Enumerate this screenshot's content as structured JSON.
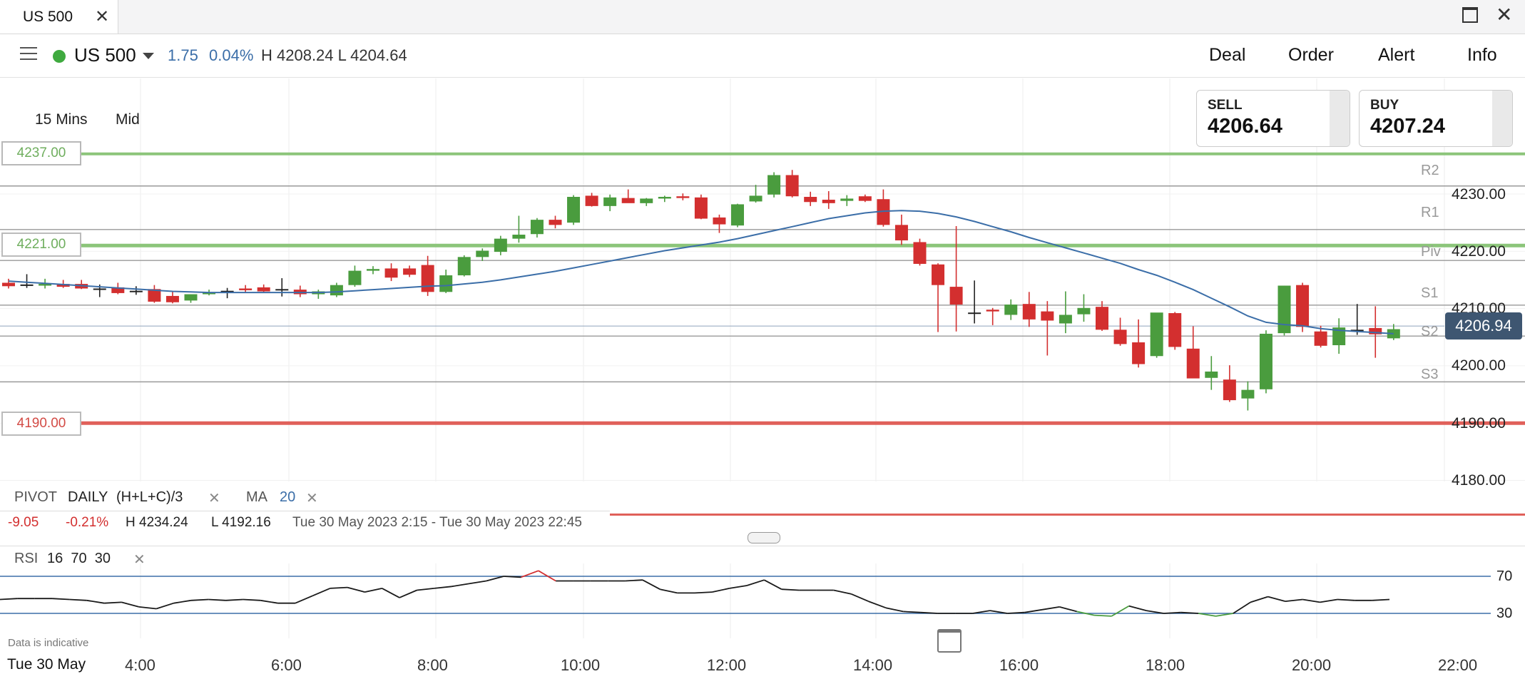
{
  "tab": {
    "title": "US 500"
  },
  "header": {
    "market": "US 500",
    "change_points": "1.75",
    "change_percent": "0.04%",
    "high_low": "H 4208.24  L 4204.64",
    "nav": [
      "Deal",
      "Order",
      "Alert",
      "Info"
    ]
  },
  "toolbar": {
    "timeframe": "15 Mins",
    "price_type": "Mid"
  },
  "quotes": {
    "sell_label": "SELL",
    "sell_price": "4206.64",
    "buy_label": "BUY",
    "buy_price": "4207.24"
  },
  "levels": {
    "upper1": "4237.00",
    "upper2": "4221.00",
    "lower1": "4190.00"
  },
  "pivot_labels": [
    "R2",
    "R1",
    "Piv",
    "S1",
    "S2",
    "S3"
  ],
  "current_price": "4206.94",
  "indicators": {
    "pivot": "PIVOT",
    "pivot_period": "DAILY",
    "pivot_formula": "(H+L+C)/3",
    "ma": "MA",
    "ma_period": "20",
    "rsi": "RSI",
    "rsi_params": "16  70  30"
  },
  "session": {
    "change": "-9.05",
    "change_pct": "-0.21%",
    "high": "H 4234.24",
    "low": "L 4192.16",
    "range": "Tue 30 May 2023 2:15 - Tue 30 May 2023 22:45"
  },
  "footer": {
    "disclaimer": "Data is indicative",
    "date": "Tue 30 May"
  },
  "colors": {
    "up": "#4a9c3e",
    "down": "#d32f2f",
    "ma": "#3b6ea8",
    "level_green": "#8cc57a",
    "level_red": "#e0605a",
    "price_tag": "#3e5671"
  },
  "chart_data": {
    "type": "candlestick",
    "x_ticks": [
      "4:00",
      "6:00",
      "8:00",
      "10:00",
      "12:00",
      "14:00",
      "16:00",
      "18:00",
      "20:00",
      "22:00"
    ],
    "y_ticks": [
      "4230.00",
      "4220.00",
      "4210.00",
      "4200.00",
      "4190.00",
      "4180.00"
    ],
    "ylim": [
      4174,
      4242
    ],
    "pivots": {
      "R2": 4231.4,
      "R1": 4223.8,
      "Piv": 4218.4,
      "S1": 4210.6,
      "S2": 4205.2,
      "S3": 4197.2
    },
    "ohlc": [
      [
        4214.5,
        4215.2,
        4213.5,
        4213.9
      ],
      [
        4214.2,
        4216.0,
        4213.6,
        4214.0
      ],
      [
        4214.0,
        4215.2,
        4213.5,
        4214.3
      ],
      [
        4214.3,
        4215.0,
        4213.6,
        4213.8
      ],
      [
        4214.3,
        4215.0,
        4213.4,
        4213.5
      ],
      [
        4213.5,
        4214.2,
        4212.0,
        4213.4
      ],
      [
        4213.7,
        4214.5,
        4212.5,
        4212.7
      ],
      [
        4213.1,
        4213.9,
        4212.4,
        4213.0
      ],
      [
        4213.4,
        4214.1,
        4211.0,
        4211.2
      ],
      [
        4212.2,
        4212.9,
        4210.9,
        4211.1
      ],
      [
        4211.4,
        4212.5,
        4211.0,
        4212.5
      ],
      [
        4212.5,
        4213.3,
        4212.3,
        4212.8
      ],
      [
        4213.0,
        4213.6,
        4211.8,
        4213.1
      ],
      [
        4213.5,
        4214.1,
        4212.8,
        4213.2
      ],
      [
        4213.7,
        4214.2,
        4212.9,
        4213.0
      ],
      [
        4213.3,
        4215.3,
        4212.1,
        4213.4
      ],
      [
        4213.3,
        4214.0,
        4212.0,
        4212.5
      ],
      [
        4212.5,
        4213.3,
        4211.7,
        4213.0
      ],
      [
        4212.3,
        4214.5,
        4212.0,
        4214.1
      ],
      [
        4214.1,
        4217.5,
        4213.8,
        4216.6
      ],
      [
        4216.6,
        4217.4,
        4216.0,
        4216.9
      ],
      [
        4217.0,
        4217.9,
        4214.8,
        4215.4
      ],
      [
        4217.0,
        4217.5,
        4215.5,
        4215.9
      ],
      [
        4217.6,
        4219.2,
        4212.2,
        4212.9
      ],
      [
        4212.9,
        4216.8,
        4212.7,
        4215.8
      ],
      [
        4215.8,
        4219.3,
        4215.6,
        4219.0
      ],
      [
        4219.0,
        4220.5,
        4218.3,
        4220.1
      ],
      [
        4219.9,
        4222.7,
        4219.3,
        4222.2
      ],
      [
        4222.2,
        4226.2,
        4221.5,
        4222.9
      ],
      [
        4223.0,
        4225.8,
        4222.4,
        4225.5
      ],
      [
        4225.5,
        4226.2,
        4224.0,
        4224.6
      ],
      [
        4225.0,
        4229.8,
        4224.6,
        4229.5
      ],
      [
        4229.7,
        4230.2,
        4227.8,
        4227.9
      ],
      [
        4227.9,
        4229.9,
        4227.0,
        4229.4
      ],
      [
        4229.3,
        4230.8,
        4228.5,
        4228.4
      ],
      [
        4228.4,
        4229.3,
        4227.9,
        4229.2
      ],
      [
        4229.2,
        4229.7,
        4228.6,
        4229.5
      ],
      [
        4229.6,
        4230.1,
        4228.9,
        4229.3
      ],
      [
        4229.4,
        4229.9,
        4225.6,
        4225.7
      ],
      [
        4225.9,
        4226.4,
        4223.2,
        4224.7
      ],
      [
        4224.5,
        4228.3,
        4224.2,
        4228.2
      ],
      [
        4228.7,
        4231.6,
        4228.5,
        4229.7
      ],
      [
        4229.9,
        4233.8,
        4229.4,
        4233.3
      ],
      [
        4233.3,
        4234.2,
        4229.4,
        4229.6
      ],
      [
        4229.5,
        4230.4,
        4227.9,
        4228.6
      ],
      [
        4229.0,
        4230.5,
        4227.4,
        4228.4
      ],
      [
        4228.8,
        4229.8,
        4227.9,
        4229.2
      ],
      [
        4229.6,
        4229.9,
        4228.6,
        4228.8
      ],
      [
        4229.1,
        4230.8,
        4224.3,
        4224.6
      ],
      [
        4224.6,
        4226.4,
        4221.1,
        4221.9
      ],
      [
        4221.6,
        4222.2,
        4217.5,
        4217.8
      ],
      [
        4217.7,
        4217.9,
        4205.9,
        4214.1
      ],
      [
        4213.8,
        4224.4,
        4206.0,
        4210.7
      ],
      [
        4209.3,
        4214.9,
        4207.4,
        4209.3
      ],
      [
        4209.8,
        4210.1,
        4207.1,
        4209.5
      ],
      [
        4208.9,
        4211.6,
        4208.0,
        4210.7
      ],
      [
        4210.8,
        4212.9,
        4206.8,
        4208.1
      ],
      [
        4209.5,
        4211.3,
        4201.8,
        4207.9
      ],
      [
        4207.4,
        4213.0,
        4205.7,
        4208.9
      ],
      [
        4209.0,
        4212.5,
        4207.7,
        4210.1
      ],
      [
        4210.3,
        4211.3,
        4206.1,
        4206.3
      ],
      [
        4206.3,
        4208.4,
        4203.5,
        4203.8
      ],
      [
        4204.1,
        4208.1,
        4199.7,
        4200.3
      ],
      [
        4201.7,
        4209.2,
        4201.4,
        4209.3
      ],
      [
        4209.2,
        4209.4,
        4202.8,
        4203.3
      ],
      [
        4203.0,
        4206.9,
        4197.9,
        4197.8
      ],
      [
        4197.9,
        4201.7,
        4195.8,
        4199.0
      ],
      [
        4197.6,
        4200.1,
        4193.7,
        4194.0
      ],
      [
        4194.3,
        4197.3,
        4192.2,
        4195.8
      ],
      [
        4195.9,
        4206.2,
        4195.2,
        4205.6
      ],
      [
        4205.7,
        4214.0,
        4205.3,
        4214.0
      ],
      [
        4214.1,
        4214.5,
        4205.9,
        4206.8
      ],
      [
        4206.0,
        4207.0,
        4203.2,
        4203.5
      ],
      [
        4203.6,
        4208.3,
        4202.1,
        4206.7
      ],
      [
        4206.3,
        4210.8,
        4205.4,
        4206.2
      ],
      [
        4206.6,
        4210.4,
        4201.4,
        4205.5
      ],
      [
        4204.8,
        4207.3,
        4204.5,
        4206.4
      ]
    ],
    "ma20": [
      4214.8,
      4214.6,
      4214.4,
      4214.2,
      4214.0,
      4213.8,
      4213.6,
      4213.4,
      4213.2,
      4213.0,
      4212.9,
      4212.8,
      4212.8,
      4212.8,
      4212.8,
      4212.8,
      4212.8,
      4212.8,
      4212.9,
      4213.1,
      4213.3,
      4213.5,
      4213.7,
      4213.9,
      4214.0,
      4214.3,
      4214.6,
      4215.0,
      4215.5,
      4216.0,
      4216.5,
      4217.1,
      4217.7,
      4218.3,
      4218.9,
      4219.5,
      4220.1,
      4220.6,
      4221.1,
      4221.6,
      4222.2,
      4222.9,
      4223.6,
      4224.3,
      4225.0,
      4225.7,
      4226.2,
      4226.7,
      4227.0,
      4227.1,
      4227.0,
      4226.6,
      4226.0,
      4225.2,
      4224.3,
      4223.4,
      4222.4,
      4221.5,
      4220.6,
      4219.7,
      4218.8,
      4217.9,
      4216.8,
      4215.8,
      4214.6,
      4213.3,
      4211.8,
      4210.3,
      4208.7,
      4207.6,
      4207.2,
      4207.0,
      4206.5,
      4206.2,
      4206.0,
      4205.8,
      4205.6
    ]
  },
  "rsi_data": {
    "levels": [
      "70",
      "30"
    ],
    "values": [
      45,
      46,
      46,
      46,
      45,
      44,
      41,
      42,
      37,
      35,
      41,
      44,
      45,
      44,
      45,
      44,
      41,
      41,
      49,
      57,
      58,
      53,
      57,
      47,
      55,
      57,
      59,
      62,
      65,
      70,
      69,
      76,
      65,
      65,
      65,
      65,
      65,
      66,
      56,
      52,
      52,
      53,
      57,
      60,
      66,
      56,
      55,
      55,
      55,
      51,
      43,
      36,
      32,
      31,
      30,
      30,
      30,
      33,
      30,
      31,
      34,
      37,
      32,
      28,
      27,
      38,
      33,
      30,
      31,
      30,
      27,
      30,
      42,
      48,
      43,
      45,
      42,
      45,
      44,
      44,
      45
    ]
  }
}
